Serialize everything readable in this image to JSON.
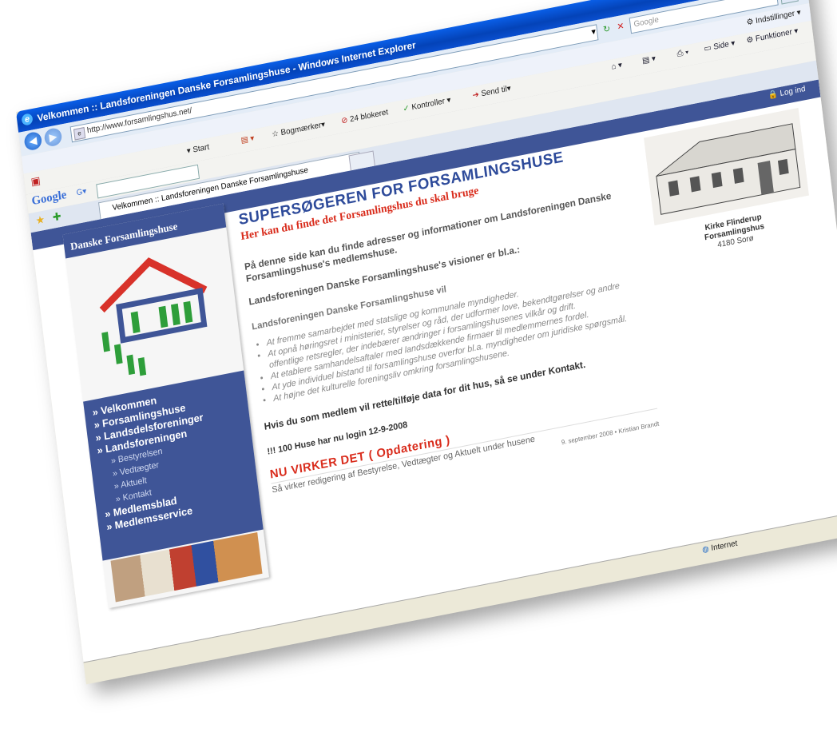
{
  "window": {
    "title": "Velkommen :: Landsforeningen Danske Forsamlingshuse - Windows Internet Explorer"
  },
  "address_bar": {
    "url": "http://www.forsamlingshus.net/",
    "search_placeholder": "Google"
  },
  "command_bar": {
    "settings_label": "Indstillinger",
    "side_label": "Side",
    "funktioner_label": "Funktioner"
  },
  "google_toolbar": {
    "logo": "Google",
    "start_label": "Start",
    "bookmarks_label": "Bogmærker",
    "blocked_label": "24 blokeret",
    "check_label": "Kontroller",
    "send_label": "Send til"
  },
  "tab": {
    "label": "Velkommen :: Landsforeningen Danske Forsamlingshuse"
  },
  "site": {
    "login_label": "Log ind",
    "sidebar_title": "Danske Forsamlingshuse",
    "menu": [
      {
        "label": "» Velkommen",
        "sub": false
      },
      {
        "label": "» Forsamlingshuse",
        "sub": false
      },
      {
        "label": "» Landsdelsforeninger",
        "sub": false
      },
      {
        "label": "» Landsforeningen",
        "sub": false
      },
      {
        "label": "» Bestyrelsen",
        "sub": true
      },
      {
        "label": "» Vedtægter",
        "sub": true
      },
      {
        "label": "» Aktuelt",
        "sub": true
      },
      {
        "label": "» Kontakt",
        "sub": true
      },
      {
        "label": "» Medlemsblad",
        "sub": false
      },
      {
        "label": "» Medlemsservice",
        "sub": false
      }
    ],
    "headline": "SUPERSØGEREN FOR FORSAMLINGSHUSE",
    "subheadline": "Her kan du finde det Forsamlingshus du skal bruge",
    "intro": "På denne side kan du finde adresser og informationer om Landsforeningen Danske Forsamlingshuse's medlemshuse.",
    "visions_heading": "Landsforeningen Danske Forsamlingshuse's visioner er bl.a.:",
    "lead": "Landsforeningen Danske Forsamlingshuse vil",
    "visions": [
      "At fremme samarbejdet med statslige og kommunale myndigheder.",
      "At opnå høringsret i ministerier, styrelser og råd, der udformer love, bekendtgørelser og andre offentlige retsregler, der indebærer ændringer i forsamlingshusenes vilkår og drift.",
      "At etablere samhandelsaftaler med landsdækkende firmaer til medlemmernes fordel.",
      "At yde individuel bistand til forsamlingshuse overfor bl.a. myndigheder om juridiske spørgsmål.",
      "At højne det kulturelle foreningsliv omkring forsamlingshusene."
    ],
    "member_text": "Hvis du som medlem vil rette/tilføje data for dit hus, så se under Kontakt.",
    "huse_text": "!!!  100 Huse har nu login 12-9-2008",
    "news_title": "NU VIRKER DET ( Opdatering )",
    "news_text": "Så virker redigering af Bestyrelse, Vedtægter og Aktuelt under husene",
    "news_date": "9. september 2008 • Kristian Brandt",
    "house_caption_name": "Kirke Flinderup",
    "house_caption_type": "Forsamlingshus",
    "house_caption_postal": "4180 Sorø"
  },
  "status_bar": {
    "zone_label": "Internet"
  }
}
